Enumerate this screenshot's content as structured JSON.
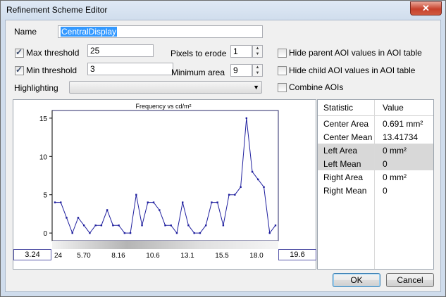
{
  "window": {
    "title": "Refinement Scheme Editor",
    "close_glyph": "✕"
  },
  "form": {
    "name_label": "Name",
    "name_value": "CentralDisplay",
    "max_threshold": {
      "label": "Max threshold",
      "checked": true,
      "value": "25"
    },
    "min_threshold": {
      "label": "Min threshold",
      "checked": true,
      "value": "3"
    },
    "pixels_to_erode": {
      "label": "Pixels to erode",
      "value": "1"
    },
    "minimum_area": {
      "label": "Minimum area",
      "value": "9"
    },
    "hide_parent": {
      "label": "Hide parent AOI values in AOI table",
      "checked": false
    },
    "hide_child": {
      "label": "Hide child AOI values in AOI table",
      "checked": false
    },
    "combine_aois": {
      "label": "Combine AOIs",
      "checked": false
    },
    "highlighting": {
      "label": "Highlighting",
      "value": ""
    }
  },
  "chart_data": {
    "type": "line",
    "title": "Frequency vs  cd/m²",
    "x_tick_labels": [
      "24",
      "5.70",
      "8.16",
      "10.6",
      "13.1",
      "15.5",
      "18.0"
    ],
    "y_ticks": [
      0,
      5,
      10,
      15
    ],
    "ylim": [
      -1,
      16
    ],
    "x_range_low": "3.24",
    "x_range_high": "19.6",
    "values": [
      4,
      4,
      2,
      0,
      2,
      1,
      0,
      1,
      1,
      3,
      1,
      1,
      0,
      0,
      5,
      1,
      4,
      4,
      3,
      1,
      1,
      0,
      4,
      1,
      0,
      0,
      1,
      4,
      4,
      1,
      5,
      5,
      6,
      15,
      8,
      7,
      6,
      0,
      1
    ],
    "colors": {
      "line": "#1f1f9e",
      "axis": "#000000",
      "frame": "#2a2a6a"
    },
    "grid": false
  },
  "stats": {
    "headers": [
      "Statistic",
      "Value"
    ],
    "rows": [
      {
        "name": "Center Area",
        "value": "0.691 mm²",
        "shaded": false
      },
      {
        "name": "Center Mean",
        "value": "13.41734",
        "shaded": false
      },
      {
        "name": "Left Area",
        "value": "0 mm²",
        "shaded": true
      },
      {
        "name": "Left Mean",
        "value": "0",
        "shaded": true
      },
      {
        "name": "Right Area",
        "value": "0 mm²",
        "shaded": false
      },
      {
        "name": "Right Mean",
        "value": "0",
        "shaded": false
      }
    ]
  },
  "buttons": {
    "ok": "OK",
    "cancel": "Cancel"
  }
}
